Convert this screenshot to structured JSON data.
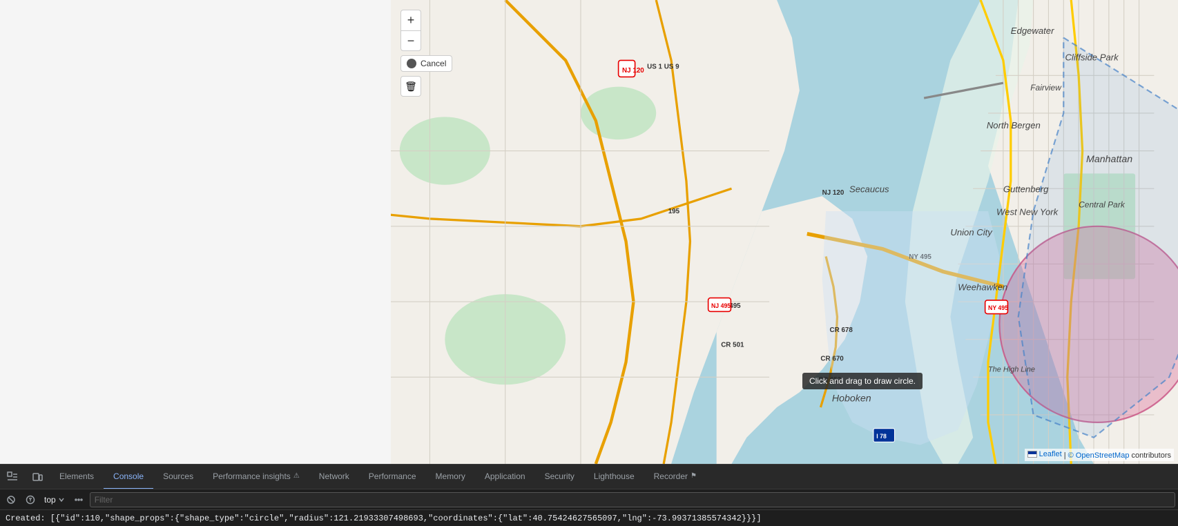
{
  "devtools": {
    "tabs": [
      {
        "id": "elements",
        "label": "Elements",
        "active": false,
        "icon": null
      },
      {
        "id": "console",
        "label": "Console",
        "active": true,
        "icon": null
      },
      {
        "id": "sources",
        "label": "Sources",
        "active": false,
        "icon": null
      },
      {
        "id": "performance-insights",
        "label": "Performance insights",
        "active": false,
        "icon": "⚠"
      },
      {
        "id": "network",
        "label": "Network",
        "active": false,
        "icon": null
      },
      {
        "id": "performance",
        "label": "Performance",
        "active": false,
        "icon": null
      },
      {
        "id": "memory",
        "label": "Memory",
        "active": false,
        "icon": null
      },
      {
        "id": "application",
        "label": "Application",
        "active": false,
        "icon": null
      },
      {
        "id": "security",
        "label": "Security",
        "active": false,
        "icon": null
      },
      {
        "id": "lighthouse",
        "label": "Lighthouse",
        "active": false,
        "icon": null
      },
      {
        "id": "recorder",
        "label": "Recorder",
        "active": false,
        "icon": "⚑"
      }
    ],
    "console_toolbar": {
      "top_label": "top",
      "filter_placeholder": "Filter"
    },
    "console_output": "Created: [{\"id\":110,\"shape_props\":{\"shape_type\":\"circle\",\"radius\":121.21933307498693,\"coordinates\":{\"lat\":40.75424627565097,\"lng\":-73.99371385574342}}}]"
  },
  "map": {
    "controls": {
      "zoom_in": "+",
      "zoom_out": "−",
      "cancel_label": "Cancel",
      "trash_icon": "🗑"
    },
    "tooltip": "Click and drag to draw circle.",
    "attribution": {
      "leaflet": "Leaflet",
      "osm": "© OpenStreetMap",
      "contributors": "contributors"
    }
  }
}
